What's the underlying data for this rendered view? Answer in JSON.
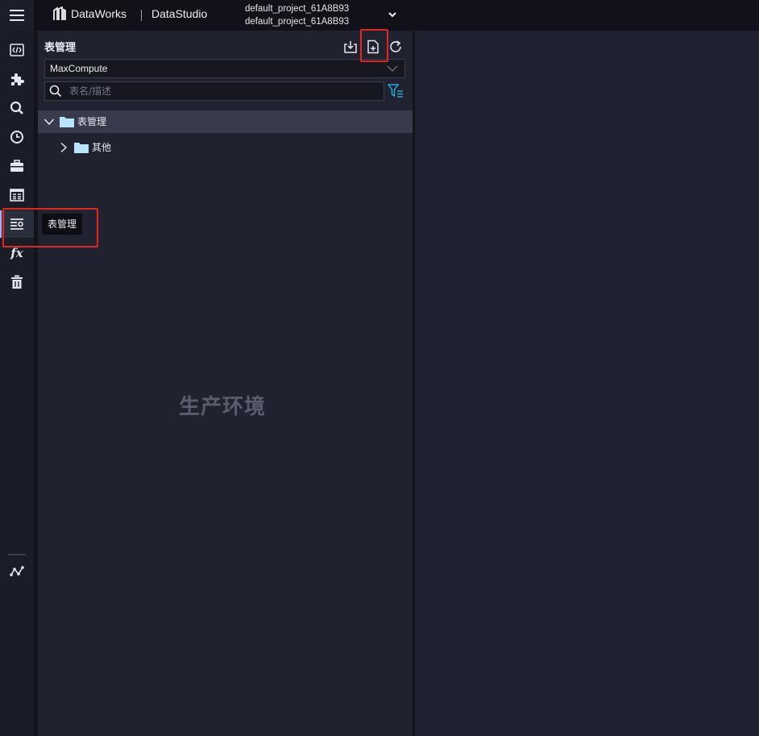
{
  "header": {
    "brand": "DataWorks",
    "product": "DataStudio",
    "project_line1": "default_project_61A8B93",
    "project_line2": "default_project_61A8B93"
  },
  "rail": {
    "items": [
      {
        "name": "data-development",
        "icon": "code-icon"
      },
      {
        "name": "components",
        "icon": "puzzle-icon"
      },
      {
        "name": "search",
        "icon": "search-icon"
      },
      {
        "name": "history",
        "icon": "clock-icon"
      },
      {
        "name": "toolkit",
        "icon": "briefcase-icon"
      },
      {
        "name": "table-view",
        "icon": "table-icon"
      },
      {
        "name": "table-management",
        "icon": "table-list-icon",
        "active": true
      },
      {
        "name": "functions",
        "icon": "fx-icon",
        "label": "fx"
      },
      {
        "name": "recycle-bin",
        "icon": "trash-icon"
      },
      {
        "name": "lineage",
        "icon": "graph-icon"
      }
    ],
    "tooltip": "表管理"
  },
  "panel": {
    "title": "表管理",
    "engine": "MaxCompute",
    "search_placeholder": "表名/描述",
    "tree": [
      {
        "label": "表管理",
        "expanded": true,
        "selected": true
      },
      {
        "label": "其他",
        "expanded": false,
        "selected": false
      }
    ],
    "watermark": "生产环境"
  },
  "colors": {
    "accent": "#9fb4ff",
    "highlight": "#e5251f",
    "folder": "#b9e4ff",
    "filter": "#2aa8d6"
  }
}
